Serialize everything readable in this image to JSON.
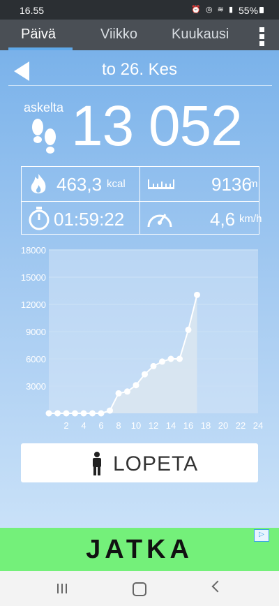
{
  "status_bar": {
    "time": "16.55",
    "icons": [
      "alarm-icon",
      "wifi-call-icon",
      "wifi-icon",
      "signal-icon"
    ],
    "battery": "55%"
  },
  "tabs": [
    {
      "label": "Päivä",
      "active": true
    },
    {
      "label": "Viikko",
      "active": false
    },
    {
      "label": "Kuukausi",
      "active": false
    }
  ],
  "date_nav": {
    "date": "to 26. Kes"
  },
  "steps": {
    "label": "askelta",
    "value": "13 052"
  },
  "stats": {
    "calories": {
      "value": "463,3",
      "unit": "kcal"
    },
    "distance": {
      "value": "9136",
      "unit": "m"
    },
    "duration": {
      "value": "01:59:22"
    },
    "speed": {
      "value": "4,6",
      "unit": "km/h"
    }
  },
  "chart_data": {
    "type": "area",
    "title": "",
    "xlabel": "",
    "ylabel": "",
    "xlim": [
      0,
      24
    ],
    "ylim": [
      0,
      18000
    ],
    "x_ticks": [
      2,
      4,
      6,
      8,
      10,
      12,
      14,
      16,
      18,
      20,
      22,
      24
    ],
    "y_ticks": [
      3000,
      6000,
      9000,
      12000,
      15000,
      18000
    ],
    "grid": true,
    "x": [
      0,
      1,
      2,
      3,
      4,
      5,
      6,
      7,
      8,
      9,
      10,
      11,
      12,
      13,
      14,
      15,
      16,
      17
    ],
    "values": [
      0,
      0,
      0,
      0,
      0,
      0,
      0,
      300,
      2200,
      2400,
      3100,
      4300,
      5200,
      5700,
      6000,
      6000,
      9200,
      13052
    ],
    "colors": {
      "line": "#ffffff",
      "point": "#ffffff",
      "fill": "#dbe6f0",
      "grid": "#c8dff5"
    }
  },
  "stop_button": {
    "label": "LOPETA"
  },
  "ad": {
    "text": "JATKA",
    "color": "#74f07a"
  }
}
